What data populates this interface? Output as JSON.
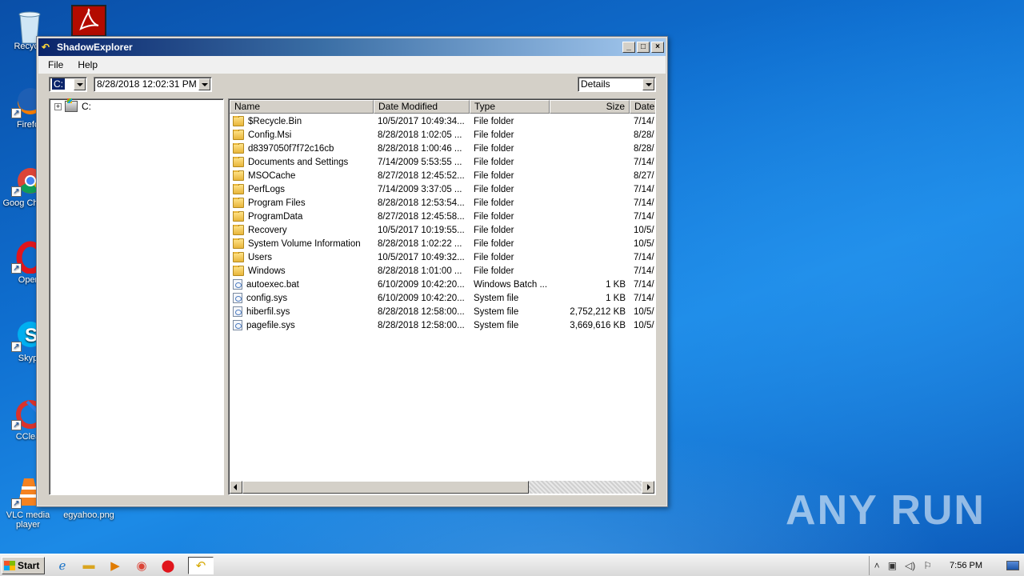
{
  "desktop": {
    "icons": [
      {
        "label": "Recycle",
        "icon": "recycle-bin-icon"
      },
      {
        "label": "Firefo",
        "icon": "firefox-icon"
      },
      {
        "label": "Goog Chrom",
        "icon": "chrome-icon"
      },
      {
        "label": "Oper",
        "icon": "opera-icon"
      },
      {
        "label": "Skyp",
        "icon": "skype-icon"
      },
      {
        "label": "CClea",
        "icon": "ccleaner-icon"
      },
      {
        "label": "VLC media player",
        "icon": "vlc-icon"
      },
      {
        "label": "egyahoo.png",
        "icon": "image-file-icon"
      }
    ],
    "watermark": "ANY RUN"
  },
  "window": {
    "title": "ShadowExplorer",
    "menu": [
      "File",
      "Help"
    ],
    "drive_value": "C:",
    "snapshot_value": "8/28/2018 12:02:31 PM",
    "view_value": "Details",
    "tree": {
      "root_label": "C:",
      "expander": "+"
    },
    "columns": [
      "Name",
      "Date Modified",
      "Type",
      "Size",
      "Date"
    ],
    "rows": [
      {
        "icon": "folder",
        "name": "$Recycle.Bin",
        "modified": "10/5/2017 10:49:34...",
        "type": "File folder",
        "size": "",
        "date": "7/14/"
      },
      {
        "icon": "folder",
        "name": "Config.Msi",
        "modified": "8/28/2018 1:02:05 ...",
        "type": "File folder",
        "size": "",
        "date": "8/28/"
      },
      {
        "icon": "folder",
        "name": "d8397050f7f72c16cb",
        "modified": "8/28/2018 1:00:46 ...",
        "type": "File folder",
        "size": "",
        "date": "8/28/"
      },
      {
        "icon": "folder",
        "name": "Documents and Settings",
        "modified": "7/14/2009 5:53:55 ...",
        "type": "File folder",
        "size": "",
        "date": "7/14/"
      },
      {
        "icon": "folder",
        "name": "MSOCache",
        "modified": "8/27/2018 12:45:52...",
        "type": "File folder",
        "size": "",
        "date": "8/27/"
      },
      {
        "icon": "folder",
        "name": "PerfLogs",
        "modified": "7/14/2009 3:37:05 ...",
        "type": "File folder",
        "size": "",
        "date": "7/14/"
      },
      {
        "icon": "folder",
        "name": "Program Files",
        "modified": "8/28/2018 12:53:54...",
        "type": "File folder",
        "size": "",
        "date": "7/14/"
      },
      {
        "icon": "folder",
        "name": "ProgramData",
        "modified": "8/27/2018 12:45:58...",
        "type": "File folder",
        "size": "",
        "date": "7/14/"
      },
      {
        "icon": "folder",
        "name": "Recovery",
        "modified": "10/5/2017 10:19:55...",
        "type": "File folder",
        "size": "",
        "date": "10/5/"
      },
      {
        "icon": "folder",
        "name": "System Volume Information",
        "modified": "8/28/2018 1:02:22 ...",
        "type": "File folder",
        "size": "",
        "date": "10/5/"
      },
      {
        "icon": "folder",
        "name": "Users",
        "modified": "10/5/2017 10:49:32...",
        "type": "File folder",
        "size": "",
        "date": "7/14/"
      },
      {
        "icon": "folder",
        "name": "Windows",
        "modified": "8/28/2018 1:01:00 ...",
        "type": "File folder",
        "size": "",
        "date": "7/14/"
      },
      {
        "icon": "file",
        "name": "autoexec.bat",
        "modified": "6/10/2009 10:42:20...",
        "type": "Windows Batch ...",
        "size": "1 KB",
        "date": "7/14/"
      },
      {
        "icon": "file",
        "name": "config.sys",
        "modified": "6/10/2009 10:42:20...",
        "type": "System file",
        "size": "1 KB",
        "date": "7/14/"
      },
      {
        "icon": "file",
        "name": "hiberfil.sys",
        "modified": "8/28/2018 12:58:00...",
        "type": "System file",
        "size": "2,752,212 KB",
        "date": "10/5/"
      },
      {
        "icon": "file",
        "name": "pagefile.sys",
        "modified": "8/28/2018 12:58:00...",
        "type": "System file",
        "size": "3,669,616 KB",
        "date": "10/5/"
      }
    ]
  },
  "taskbar": {
    "start_label": "Start",
    "apps": [
      "internet-explorer-icon",
      "folder-icon",
      "media-player-icon",
      "chrome-icon",
      "opera-icon"
    ],
    "active_app": "shadowexplorer-icon",
    "clock": "7:56 PM"
  },
  "colors": {
    "titlebar_start": "#0a246a",
    "titlebar_end": "#a6caf0",
    "selection": "#0a246a"
  }
}
